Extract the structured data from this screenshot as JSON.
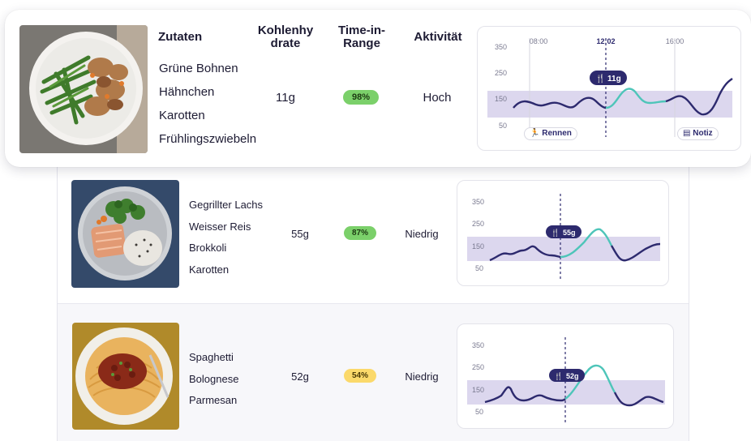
{
  "colors": {
    "navy": "#2d2a6e",
    "teal": "#4ec5b9",
    "band": "#dcd7ee",
    "green_badge": "#7bd06a",
    "yellow_badge": "#fbd96b"
  },
  "header": {
    "ingredients": "Zutaten",
    "carbs": "Kohlenhy drate",
    "tir": "Time-in- Range",
    "activity": "Aktivität"
  },
  "meals": [
    {
      "ingredients": [
        "Grüne Bohnen",
        "Hähnchen",
        "Karotten",
        "Frühlingszwiebeln"
      ],
      "carbs": "11g",
      "tir": "98%",
      "tir_level": "green",
      "activity": "Hoch",
      "chart": {
        "y_ticks": [
          "350",
          "250",
          "150",
          "50"
        ],
        "times": [
          "08:00",
          "12:02",
          "16:00"
        ],
        "highlight_time": "12:02",
        "meal_label": "11g",
        "chips": [
          "Rennen",
          "Notiz"
        ],
        "chip_icons": [
          "running-icon",
          "note-icon"
        ]
      }
    },
    {
      "ingredients": [
        "Gegrillter Lachs",
        "Weisser Reis",
        "Brokkoli",
        "Karotten"
      ],
      "carbs": "55g",
      "tir": "87%",
      "tir_level": "green",
      "activity": "Niedrig",
      "chart": {
        "y_ticks": [
          "350",
          "250",
          "150",
          "50"
        ],
        "meal_label": "55g"
      }
    },
    {
      "ingredients": [
        "Spaghetti",
        "Bolognese",
        "Parmesan"
      ],
      "carbs": "52g",
      "tir": "54%",
      "tir_level": "yellow",
      "activity": "Niedrig",
      "chart": {
        "y_ticks": [
          "350",
          "250",
          "150",
          "50"
        ],
        "meal_label": "52g"
      }
    }
  ]
}
